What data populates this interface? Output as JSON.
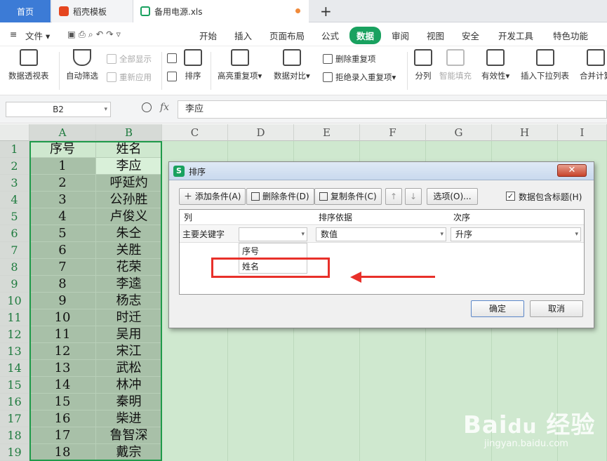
{
  "tabs": {
    "home": "首页",
    "daoke": "稻壳模板",
    "file": "备用电源.xls",
    "new_tab": "+"
  },
  "menu": {
    "file": "文件",
    "items": [
      "开始",
      "插入",
      "页面布局",
      "公式",
      "数据",
      "审阅",
      "视图",
      "安全",
      "开发工具",
      "特色功能"
    ],
    "active": "数据"
  },
  "ribbon": {
    "pivot": "数据透视表",
    "autofilter": "自动筛选",
    "show_all": "全部显示",
    "reapply": "重新应用",
    "sort": "排序",
    "highlight_dup": "高亮重复项",
    "compare": "数据对比",
    "remove_dup": "删除重复项",
    "reject_dup": "拒绝录入重复项",
    "split": "分列",
    "smart_fill": "智能填充",
    "validity": "有效性",
    "insert_dropdown": "插入下拉列表",
    "merge_calc": "合并计算"
  },
  "formula": {
    "cell_ref": "B2",
    "fx": "fx",
    "value": "李应"
  },
  "columns": [
    "A",
    "B",
    "C",
    "D",
    "E",
    "F",
    "G",
    "H",
    "I"
  ],
  "rows": [
    {
      "n": "1",
      "a": "序号",
      "b": "姓名"
    },
    {
      "n": "2",
      "a": "1",
      "b": "李应"
    },
    {
      "n": "3",
      "a": "2",
      "b": "呼延灼"
    },
    {
      "n": "4",
      "a": "3",
      "b": "公孙胜"
    },
    {
      "n": "5",
      "a": "4",
      "b": "卢俊义"
    },
    {
      "n": "6",
      "a": "5",
      "b": "朱仝"
    },
    {
      "n": "7",
      "a": "6",
      "b": "关胜"
    },
    {
      "n": "8",
      "a": "7",
      "b": "花荣"
    },
    {
      "n": "9",
      "a": "8",
      "b": "李逵"
    },
    {
      "n": "10",
      "a": "9",
      "b": "杨志"
    },
    {
      "n": "11",
      "a": "10",
      "b": "时迁"
    },
    {
      "n": "12",
      "a": "11",
      "b": "吴用"
    },
    {
      "n": "13",
      "a": "12",
      "b": "宋江"
    },
    {
      "n": "14",
      "a": "13",
      "b": "武松"
    },
    {
      "n": "15",
      "a": "14",
      "b": "林冲"
    },
    {
      "n": "16",
      "a": "15",
      "b": "秦明"
    },
    {
      "n": "17",
      "a": "16",
      "b": "柴进"
    },
    {
      "n": "18",
      "a": "17",
      "b": "鲁智深"
    },
    {
      "n": "19",
      "a": "18",
      "b": "戴宗"
    }
  ],
  "dialog": {
    "title": "排序",
    "logo": "S",
    "add_condition": "添加条件(A)",
    "delete_condition": "删除条件(D)",
    "copy_condition": "复制条件(C)",
    "options": "选项(O)...",
    "header_checkbox": "数据包含标题(H)",
    "header_checked": true,
    "col_header": "列",
    "basis_header": "排序依据",
    "order_header": "次序",
    "primary_key": "主要关键字",
    "key_value": "",
    "basis_value": "数值",
    "order_value": "升序",
    "dropdown_options": [
      "序号",
      "姓名"
    ],
    "ok": "确定",
    "cancel": "取消"
  },
  "colors": {
    "accent": "#19a15f",
    "sheet_bg": "#cfe8cf",
    "annotation": "#e8302a"
  }
}
